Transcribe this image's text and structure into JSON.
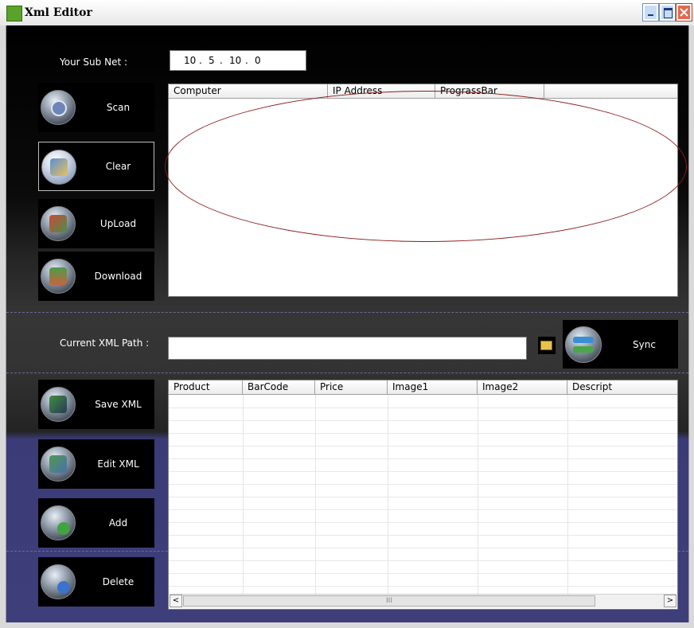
{
  "window": {
    "title": "Xml Editor",
    "icon": "xml-app-icon"
  },
  "subnet": {
    "label": "Your Sub Net :",
    "octets": [
      "10",
      "5",
      "10",
      "0"
    ]
  },
  "buttons": {
    "scan": "Scan",
    "clear": "Clear",
    "upload": "UpLoad",
    "download": "Download",
    "sync": "Sync",
    "save_xml": "Save XML",
    "edit_xml": "Edit XML",
    "add": "Add",
    "delete": "Delete"
  },
  "computers_table": {
    "columns": [
      "Computer",
      "IP Address",
      "PrograssBar"
    ]
  },
  "xml_path": {
    "label": "Current XML Path :",
    "value": ""
  },
  "products_table": {
    "columns": [
      "Product",
      "BarCode",
      "Price",
      "Image1",
      "Image2",
      "Descript"
    ]
  },
  "scrollbar": {
    "left_arrow": "<",
    "right_arrow": ">",
    "thumb_grip": "III"
  },
  "colors": {
    "panel_top": "#000000",
    "panel_bottom": "#3e3e7a",
    "annotation": "#8b1a1a"
  }
}
